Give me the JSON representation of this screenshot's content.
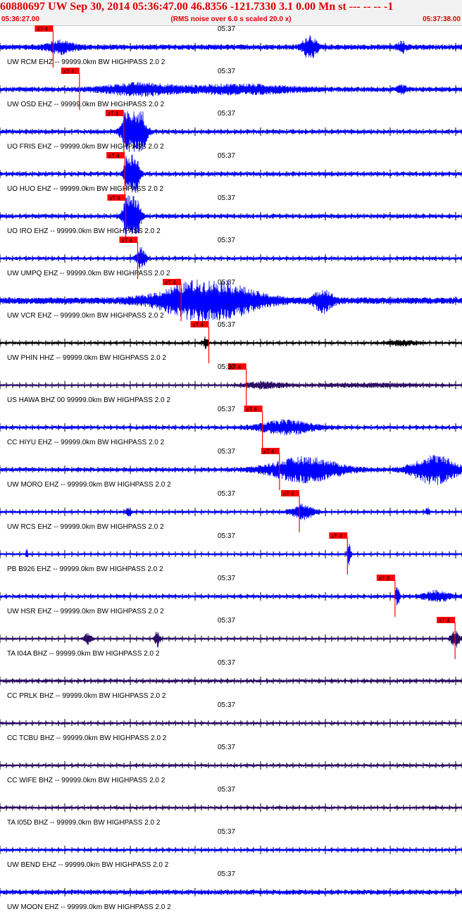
{
  "header": {
    "title": "60880697 UW Sep 30, 2014 05:36:47.00   46.8356 -121.7330  3.1 0.00 Mn st --- -- --  -1",
    "start_time": "05:36:27.00",
    "note": "(RMS noise over 6.0 s scaled 20.0 x)",
    "end_time": "05:37:38.00"
  },
  "colors": {
    "title": "#e00000",
    "pick_marker": "#ff0000",
    "trace_blue": "#0000ff",
    "trace_black": "#000000",
    "trace_purple": "#2b0a66",
    "axis": "#000000"
  },
  "channels": [
    {
      "label": "UW RCM EHZ -- 99999.0km BW  HIGHPASS  2.0  2",
      "time_mark": "05:37",
      "pick": "xT 4",
      "pick_pos": 0.115,
      "amp": 0.45,
      "color": "trace_blue",
      "bursts": [
        [
          0.13,
          0.03,
          2.2
        ],
        [
          0.67,
          0.015,
          4.5
        ],
        [
          0.87,
          0.01,
          1.8
        ]
      ]
    },
    {
      "label": "UW OSD EHZ -- 99999.0km BW  HIGHPASS  2.0  2",
      "time_mark": "05:37",
      "pick": "xT 4",
      "pick_pos": 0.172,
      "amp": 0.4,
      "color": "trace_blue",
      "bursts": [
        [
          0.3,
          0.08,
          2.3
        ],
        [
          0.52,
          0.12,
          1.8
        ],
        [
          0.87,
          0.01,
          1.5
        ]
      ]
    },
    {
      "label": "UO FRIS EHZ -- 99999.0km BW  HIGHPASS  2.0  2",
      "time_mark": "05:37",
      "pick": "xT 4",
      "pick_pos": 0.268,
      "amp": 0.35,
      "color": "trace_blue",
      "bursts": [
        [
          0.29,
          0.02,
          25
        ]
      ]
    },
    {
      "label": "UO HUO EHZ -- 99999.0km BW  HIGHPASS  2.0  2",
      "time_mark": "05:37",
      "pick": "xT 4",
      "pick_pos": 0.27,
      "amp": 0.35,
      "color": "trace_blue",
      "bursts": [
        [
          0.285,
          0.012,
          25
        ]
      ]
    },
    {
      "label": "UO IRO EHZ -- 99999.0km BW  HIGHPASS  2.0  2",
      "time_mark": "05:37",
      "pick": "xT 4",
      "pick_pos": 0.272,
      "amp": 0.35,
      "color": "trace_blue",
      "bursts": [
        [
          0.285,
          0.014,
          25
        ]
      ]
    },
    {
      "label": "UW UMPQ EHZ -- 99999.0km BW  HIGHPASS  2.0  2",
      "time_mark": "05:37",
      "pick": "xT 4",
      "pick_pos": 0.298,
      "amp": 0.3,
      "color": "trace_blue",
      "bursts": [
        [
          0.305,
          0.01,
          6
        ]
      ]
    },
    {
      "label": "UW VCR EHZ -- 99999.0km BW  HIGHPASS  2.0  2",
      "time_mark": "05:37",
      "pick": "xT 4",
      "pick_pos": 0.392,
      "amp": 0.6,
      "color": "trace_blue",
      "bursts": [
        [
          0.45,
          0.1,
          6
        ],
        [
          0.7,
          0.02,
          3
        ]
      ]
    },
    {
      "label": "UW PHIN HHZ -- 99999.0km BW  HIGHPASS  2.0  2",
      "time_mark": "05:37",
      "pick": "xT 4",
      "pick_pos": 0.452,
      "amp": 0.25,
      "color": "trace_black",
      "bursts": [
        [
          0.445,
          0.005,
          4
        ],
        [
          0.87,
          0.03,
          1.5
        ]
      ]
    },
    {
      "label": "US HAWA BHZ 00 99999.0km BW  HIGHPASS  2.0  2",
      "time_mark": "05:37",
      "pick": "xT 4",
      "pick_pos": 0.533,
      "amp": 0.18,
      "color": "trace_purple",
      "bursts": [
        [
          0.57,
          0.05,
          3
        ],
        [
          0.8,
          0.15,
          1.6
        ]
      ]
    },
    {
      "label": "CC HIYU EHZ -- 99999.0km BW  HIGHPASS  2.0  2",
      "time_mark": "05:37",
      "pick": "xT 4",
      "pick_pos": 0.568,
      "amp": 0.3,
      "color": "trace_blue",
      "bursts": [
        [
          0.62,
          0.06,
          4
        ]
      ]
    },
    {
      "label": "UW MORO EHZ -- 99999.0km BW  HIGHPASS  2.0  2",
      "time_mark": "05:37",
      "pick": "xT 4",
      "pick_pos": 0.605,
      "amp": 0.35,
      "color": "trace_blue",
      "bursts": [
        [
          0.66,
          0.08,
          6
        ],
        [
          0.94,
          0.05,
          7
        ]
      ]
    },
    {
      "label": "UW RCS EHZ -- 99999.0km BW  HIGHPASS  2.0  2",
      "time_mark": "05:37",
      "pick": "xT 4",
      "pick_pos": 0.648,
      "amp": 0.25,
      "color": "trace_blue",
      "bursts": [
        [
          0.655,
          0.025,
          5
        ],
        [
          0.278,
          0.005,
          3
        ],
        [
          0.925,
          0.004,
          3
        ]
      ]
    },
    {
      "label": "PB B926 EHZ -- 99999.0km BW  HIGHPASS  2.0  2",
      "time_mark": "05:37",
      "pick": "xT 4",
      "pick_pos": 0.752,
      "amp": 0.2,
      "color": "trace_blue",
      "bursts": [
        [
          0.755,
          0.004,
          10
        ],
        [
          0.058,
          0.002,
          5
        ]
      ]
    },
    {
      "label": "UW HSR EHZ -- 99999.0km BW  HIGHPASS  2.0  2",
      "time_mark": "05:37",
      "pick": "xT 4",
      "pick_pos": 0.855,
      "amp": 0.3,
      "color": "trace_blue",
      "bursts": [
        [
          0.945,
          0.03,
          3
        ],
        [
          0.86,
          0.004,
          6
        ]
      ]
    },
    {
      "label": "TA I04A BHZ -- 99999.0km BW  HIGHPASS  2.0  2",
      "time_mark": "05:37",
      "pick": "xT 4",
      "pick_pos": 0.985,
      "amp": 0.2,
      "color": "trace_purple",
      "bursts": [
        [
          0.19,
          0.008,
          5
        ],
        [
          0.34,
          0.006,
          7
        ],
        [
          0.985,
          0.01,
          8
        ]
      ]
    },
    {
      "label": "CC PRLK BHZ -- 99999.0km BW  HIGHPASS  2.0  2",
      "time_mark": "05:37",
      "amp": 0.3,
      "color": "trace_purple",
      "bursts": []
    },
    {
      "label": "CC TCBU BHZ -- 99999.0km BW  HIGHPASS  2.0  2",
      "time_mark": "05:37",
      "amp": 0.25,
      "color": "trace_purple",
      "bursts": []
    },
    {
      "label": "CC WIFE BHZ -- 99999.0km BW  HIGHPASS  2.0  2",
      "time_mark": "05:37",
      "amp": 0.25,
      "color": "trace_purple",
      "bursts": []
    },
    {
      "label": "TA I05D BHZ -- 99999.0km BW  HIGHPASS  2.0  2",
      "time_mark": "05:37",
      "amp": 0.25,
      "color": "trace_purple",
      "bursts": []
    },
    {
      "label": "UW BEND EHZ -- 99999.0km BW  HIGHPASS  2.0  2",
      "time_mark": "05:37",
      "amp": 0.28,
      "color": "trace_blue",
      "bursts": []
    },
    {
      "label": "UW MOON EHZ -- 99999.0km BW  HIGHPASS  2.0  2",
      "time_mark": "05:37",
      "amp": 0.4,
      "color": "trace_blue",
      "bursts": []
    }
  ]
}
